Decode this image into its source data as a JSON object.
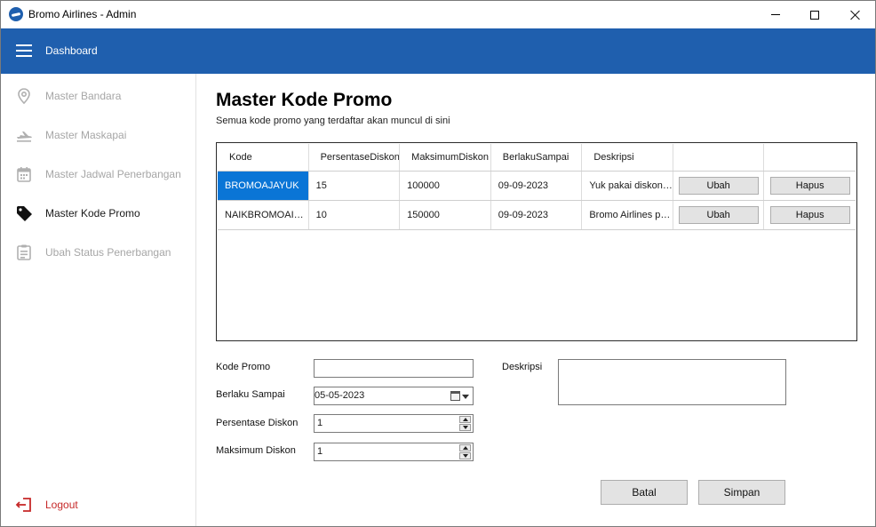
{
  "window": {
    "title": "Bromo Airlines - Admin"
  },
  "header": {
    "title": "Dashboard"
  },
  "sidebar": {
    "items": [
      {
        "label": "Master Bandara",
        "icon": "location-pin-icon",
        "state": "disabled"
      },
      {
        "label": "Master Maskapai",
        "icon": "airplane-icon",
        "state": "disabled"
      },
      {
        "label": "Master Jadwal Penerbangan",
        "icon": "calendar-icon",
        "state": "disabled"
      },
      {
        "label": "Master Kode Promo",
        "icon": "tag-icon",
        "state": "active"
      },
      {
        "label": "Ubah Status Penerbangan",
        "icon": "document-icon",
        "state": "disabled"
      }
    ],
    "logout_label": "Logout"
  },
  "page": {
    "title": "Master Kode Promo",
    "subtitle": "Semua kode promo yang terdaftar akan muncul di sini"
  },
  "table": {
    "columns": [
      "Kode",
      "PersentaseDiskon",
      "MaksimumDiskon",
      "BerlakuSampai",
      "Deskripsi",
      "",
      ""
    ],
    "rows": [
      {
        "kode": "BROMOAJAYUK",
        "persentase": "15",
        "maksimum": "100000",
        "berlaku": "09-09-2023",
        "deskripsi": "Yuk pakai diskon ini!",
        "ubah": "Ubah",
        "hapus": "Hapus",
        "selected": true
      },
      {
        "kode": "NAIKBROMOAIRLINES",
        "persentase": "10",
        "maksimum": "150000",
        "berlaku": "09-09-2023",
        "deskripsi": "Bromo Airlines promo",
        "ubah": "Ubah",
        "hapus": "Hapus",
        "selected": false
      }
    ]
  },
  "form": {
    "kode_label": "Kode Promo",
    "kode_value": "",
    "berlaku_label": "Berlaku Sampai",
    "berlaku_value": "05-05-2023",
    "persentase_label": "Persentase Diskon",
    "persentase_value": "1",
    "maksimum_label": "Maksimum Diskon",
    "maksimum_value": "1",
    "deskripsi_label": "Deskripsi",
    "deskripsi_value": ""
  },
  "actions": {
    "batal": "Batal",
    "simpan": "Simpan"
  },
  "colors": {
    "header": "#1f5fae",
    "selection": "#0a75d6",
    "logout": "#c62828"
  }
}
